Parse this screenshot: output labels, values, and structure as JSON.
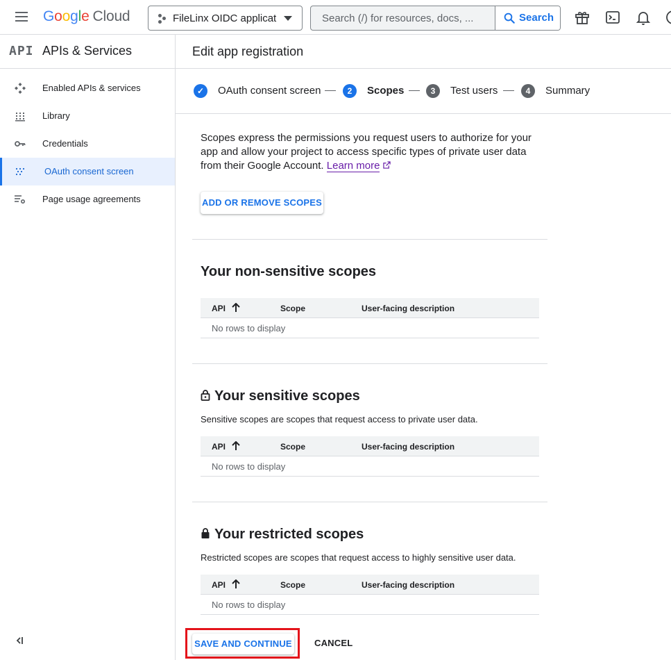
{
  "header": {
    "logo": {
      "letters": [
        "G",
        "o",
        "o",
        "g",
        "l",
        "e"
      ],
      "suffix": "Cloud"
    },
    "project_name": "FileLinx OIDC applicatie",
    "search_placeholder": "Search (/) for resources, docs, ...",
    "search_button": "Search"
  },
  "sidebar": {
    "api_badge": "API",
    "title": "APIs & Services",
    "items": [
      {
        "label": "Enabled APIs & services",
        "icon": "dashboard-icon",
        "active": false
      },
      {
        "label": "Library",
        "icon": "library-icon",
        "active": false
      },
      {
        "label": "Credentials",
        "icon": "key-icon",
        "active": false
      },
      {
        "label": "OAuth consent screen",
        "icon": "consent-grid-icon",
        "active": true
      },
      {
        "label": "Page usage agreements",
        "icon": "settings-list-icon",
        "active": false
      }
    ]
  },
  "main": {
    "title": "Edit app registration",
    "steps": [
      {
        "marker": "✓",
        "label": "OAuth consent screen",
        "state": "done"
      },
      {
        "marker": "2",
        "label": "Scopes",
        "state": "current"
      },
      {
        "marker": "3",
        "label": "Test users",
        "state": "upcoming"
      },
      {
        "marker": "4",
        "label": "Summary",
        "state": "upcoming"
      }
    ],
    "intro": "Scopes express the permissions you request users to authorize for your app and allow your project to access specific types of private user data from their Google Account.",
    "learn_more": "Learn more",
    "add_button": "ADD OR REMOVE SCOPES",
    "table_headers": {
      "api": "API",
      "scope": "Scope",
      "description": "User-facing description"
    },
    "empty_text": "No rows to display",
    "sections": [
      {
        "title": "Your non-sensitive scopes",
        "description": ""
      },
      {
        "title": "Your sensitive scopes",
        "description": "Sensitive scopes are scopes that request access to private user data."
      },
      {
        "title": "Your restricted scopes",
        "description": "Restricted scopes are scopes that request access to highly sensitive user data."
      }
    ],
    "save_button": "SAVE AND CONTINUE",
    "cancel_button": "CANCEL"
  },
  "colors": {
    "accent": "#1a73e8",
    "highlight_box": "#e4141b",
    "active_bg": "#e8f0fe",
    "link_visited": "#681da8"
  }
}
